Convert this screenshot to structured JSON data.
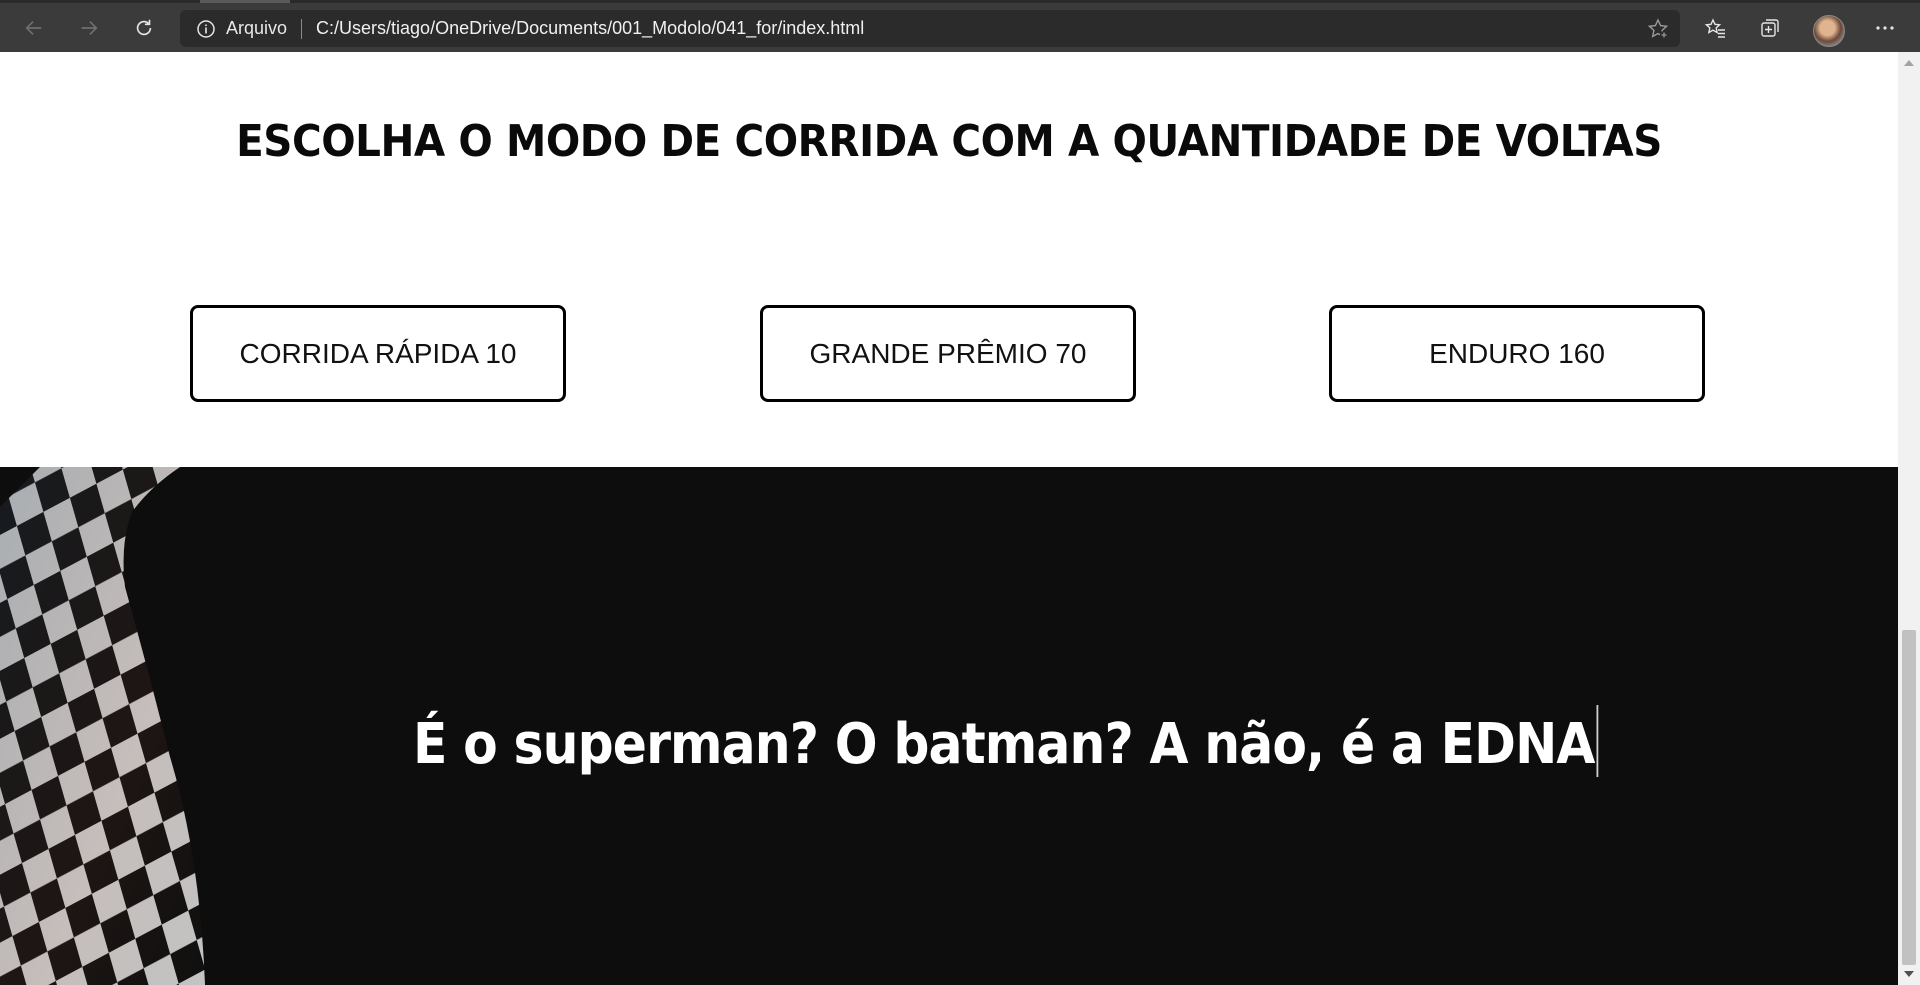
{
  "browser": {
    "site_label": "Arquivo",
    "url": "C:/Users/tiago/OneDrive/Documents/001_Modolo/041_for/index.html",
    "icons": [
      "back-icon",
      "forward-icon",
      "refresh-icon",
      "info-icon",
      "add-favorite-icon",
      "favorites-icon",
      "collections-icon",
      "profile-avatar",
      "more-icon"
    ]
  },
  "page": {
    "heading": "ESCOLHA O MODO DE CORRIDA COM A QUANTIDADE DE VOLTAS",
    "modes": [
      {
        "label": "CORRIDA RÁPIDA 10"
      },
      {
        "label": "GRANDE PRÊMIO 70"
      },
      {
        "label": "ENDURO 160"
      }
    ],
    "tagline": "É o superman? O batman? A não, é a EDNA"
  },
  "colors": {
    "chrome": "#3b3b3b",
    "address_bar": "#2b2b2b",
    "page_bg": "#ffffff",
    "dark_section": "#0d0d0d",
    "button_border": "#000000"
  }
}
